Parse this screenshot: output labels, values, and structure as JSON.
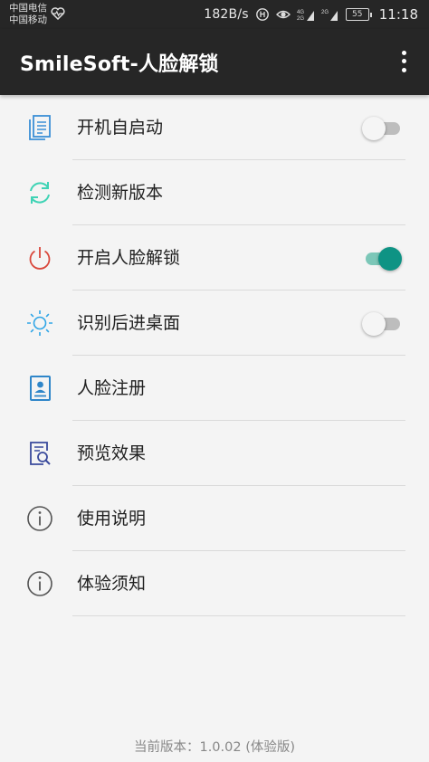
{
  "status_bar": {
    "carrier_1": "中国电信",
    "carrier_2": "中国移动",
    "net_speed": "182B/s",
    "battery": "55",
    "time": "11:18"
  },
  "app_bar": {
    "title": "SmileSoft-人脸解锁"
  },
  "colors": {
    "bar_bg": "#262626",
    "accent": "#0e9384",
    "icon_blue": "#3b8fd6",
    "icon_teal": "#3fd3b5",
    "icon_red": "#d9473b",
    "icon_sky": "#2fa5e6"
  },
  "settings": [
    {
      "label": "开机自启动",
      "icon": "document-icon",
      "switch": "off"
    },
    {
      "label": "检测新版本",
      "icon": "refresh-icon"
    },
    {
      "label": "开启人脸解锁",
      "icon": "power-icon",
      "switch": "on"
    },
    {
      "label": "识别后进桌面",
      "icon": "sun-icon",
      "switch": "off"
    },
    {
      "label": "人脸注册",
      "icon": "id-card-icon"
    },
    {
      "label": "预览效果",
      "icon": "preview-search-icon"
    },
    {
      "label": "使用说明",
      "icon": "info-icon"
    },
    {
      "label": "体验须知",
      "icon": "info-icon"
    }
  ],
  "footer": {
    "version": "当前版本：1.0.02 (体验版)"
  }
}
